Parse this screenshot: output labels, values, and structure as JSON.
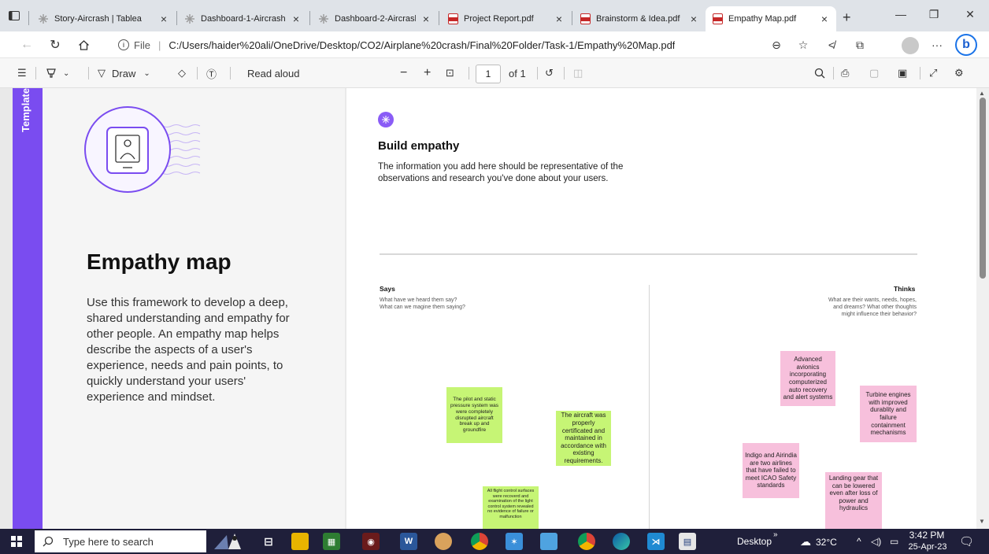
{
  "tabs": [
    {
      "title": "Story-Aircrash | Tablea",
      "favicon": "tableau-icon",
      "active": false
    },
    {
      "title": "Dashboard-1-Aircrash",
      "favicon": "tableau-icon",
      "active": false
    },
    {
      "title": "Dashboard-2-Aircrash",
      "favicon": "tableau-icon",
      "active": false
    },
    {
      "title": "Project Report.pdf",
      "favicon": "pdf-icon",
      "active": false
    },
    {
      "title": "Brainstorm & Idea.pdf",
      "favicon": "pdf-icon",
      "active": false
    },
    {
      "title": "Empathy Map.pdf",
      "favicon": "pdf-icon",
      "active": true
    }
  ],
  "address": {
    "scheme": "File",
    "url": "C:/Users/haider%20ali/OneDrive/Desktop/CO2/Airplane%20crash/Final%20Folder/Task-1/Empathy%20Map.pdf"
  },
  "pdf_toolbar": {
    "draw_label": "Draw",
    "read_aloud_label": "Read aloud",
    "page_current": "1",
    "page_total_label": "of 1"
  },
  "left_page": {
    "side_tab": "Template",
    "title": "Empathy map",
    "description": "Use this framework to develop a deep, shared understanding and empathy for other people. An empathy map helps describe the aspects of a user's experience, needs and pain points, to quickly understand your users' experience and mindset."
  },
  "right_page": {
    "title": "Build empathy",
    "description": "The information you add here should be representative of the observations and research you've done about your users.",
    "says": {
      "title": "Says",
      "line1": "What have we heard them say?",
      "line2": "What can we magine them saying?"
    },
    "thinks": {
      "title": "Thinks",
      "line1": "What are their wants, needs, hopes,",
      "line2": "and dreams? What other thoughts",
      "line3": "might influence their behavior?"
    },
    "notes_says": [
      "The pilot and static pressure system was were completely disrupted aircraft break up and groundfire",
      "The aircraft was properly certificated and maintained in accordance with existing requirements.",
      "All flight control surfaces were recoverd and examination of the light control system revealed no evidence of failure or malfunction"
    ],
    "notes_thinks": [
      "Advanced avionics incorporating computerized auto recovery and alert systems",
      "Turbine engines with improved durablity and failure containment mechanisms",
      "Indigo and Airindia are two airlines that have failed to meet ICAO Safety standards",
      "Landing gear that can be lowered even after loss of power and hydraulics"
    ]
  },
  "taskbar": {
    "search_placeholder": "Type here to search",
    "desktop_label": "Desktop",
    "temperature": "32°C",
    "time": "3:42 PM",
    "date": "25-Apr-23"
  },
  "colors": {
    "accent_purple": "#7a4cf0",
    "note_green": "#c6f575",
    "note_pink": "#f7c0dc",
    "taskbar": "#1f1f3a"
  }
}
